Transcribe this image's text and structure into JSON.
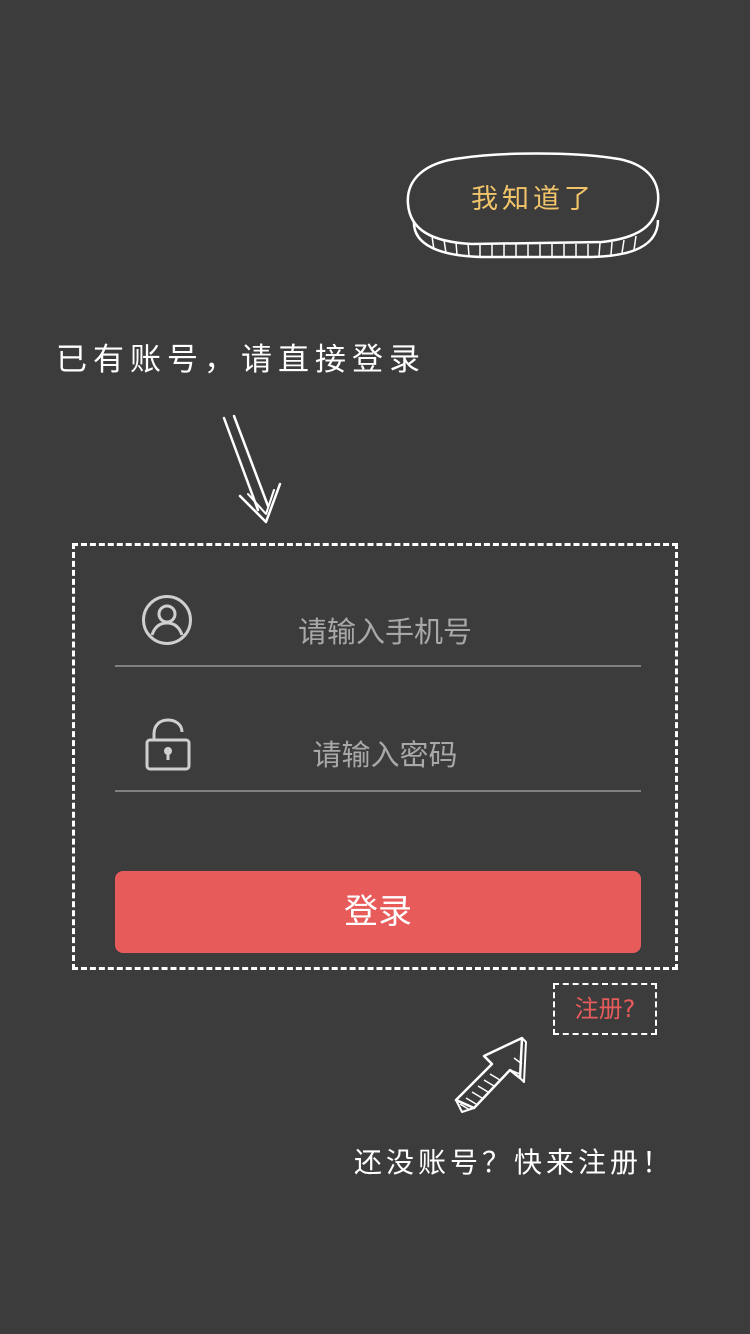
{
  "guide": {
    "got_it_label": "我知道了",
    "login_hint": "已有账号，请直接登录",
    "register_hint": "还没账号？快来注册！"
  },
  "login_form": {
    "phone_placeholder": "请输入手机号",
    "password_placeholder": "请输入密码",
    "login_button": "登录",
    "register_link": "注册?",
    "icons": {
      "phone": "user-icon",
      "password": "lock-icon"
    }
  },
  "colors": {
    "background": "#3c3c3c",
    "accent": "#e85b5b",
    "got_it_text": "#f1c46a"
  }
}
